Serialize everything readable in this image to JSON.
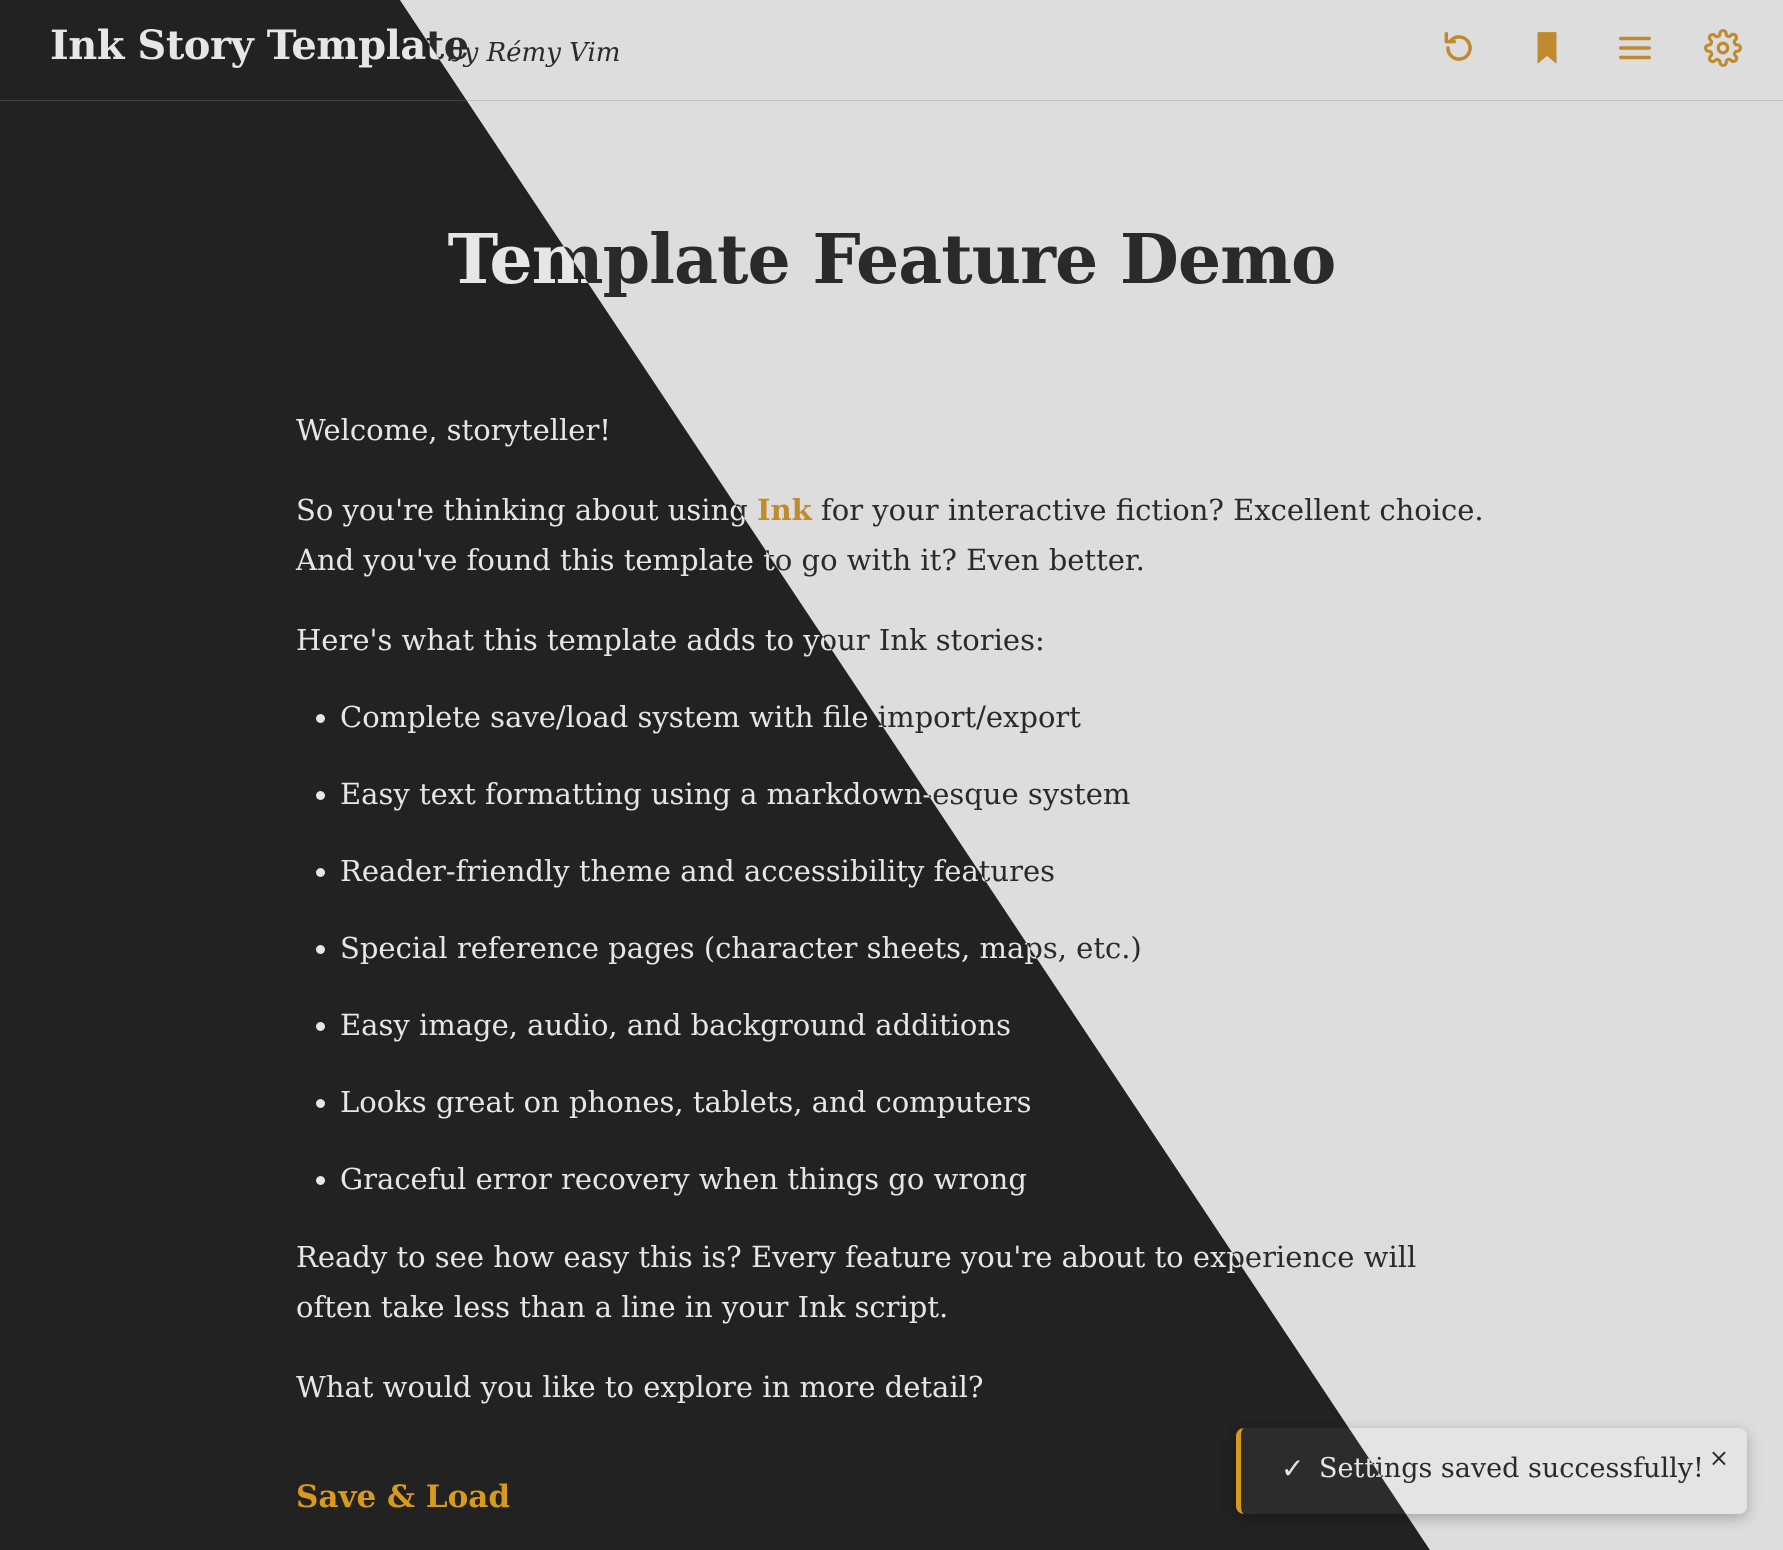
{
  "header": {
    "title": "Ink Story Template",
    "author": "by Rémy Vim"
  },
  "toolbar": {
    "buttons": [
      {
        "name": "restart",
        "icon": "restart-icon"
      },
      {
        "name": "bookmark",
        "icon": "bookmark-icon"
      },
      {
        "name": "menu",
        "icon": "menu-icon"
      },
      {
        "name": "settings",
        "icon": "gear-icon"
      }
    ]
  },
  "story": {
    "title": "Template Feature Demo",
    "welcome": "Welcome, storyteller!",
    "intro_before": "So you're thinking about using ",
    "intro_link": "Ink",
    "intro_after": " for your interactive fiction? Excellent choice. And you've found this template to go with it? Even better.",
    "adds": "Here's what this template adds to your Ink stories:",
    "features": [
      "Complete save/load system with file import/export",
      "Easy text formatting using a markdown-esque system",
      "Reader-friendly theme and accessibility features",
      "Special reference pages (character sheets, maps, etc.)",
      "Easy image, audio, and background additions",
      "Looks great on phones, tablets, and computers",
      "Graceful error recovery when things go wrong"
    ],
    "ready": "Ready to see how easy this is? Every feature you're about to experience will often take less than a line in your Ink script.",
    "explore": "What would you like to explore in more detail?",
    "choice": "Save & Load"
  },
  "toast": {
    "check": "✓",
    "message": "Settings saved successfully!",
    "close": "×"
  },
  "colors": {
    "dark_bg": "#222222",
    "light_bg": "#dddddd",
    "dark_text": "#e6e6e6",
    "light_text": "#2a2a2a",
    "accent": "#c08a2e",
    "choice_dark": "#d89a1c",
    "choice_light": "#b07a18"
  }
}
